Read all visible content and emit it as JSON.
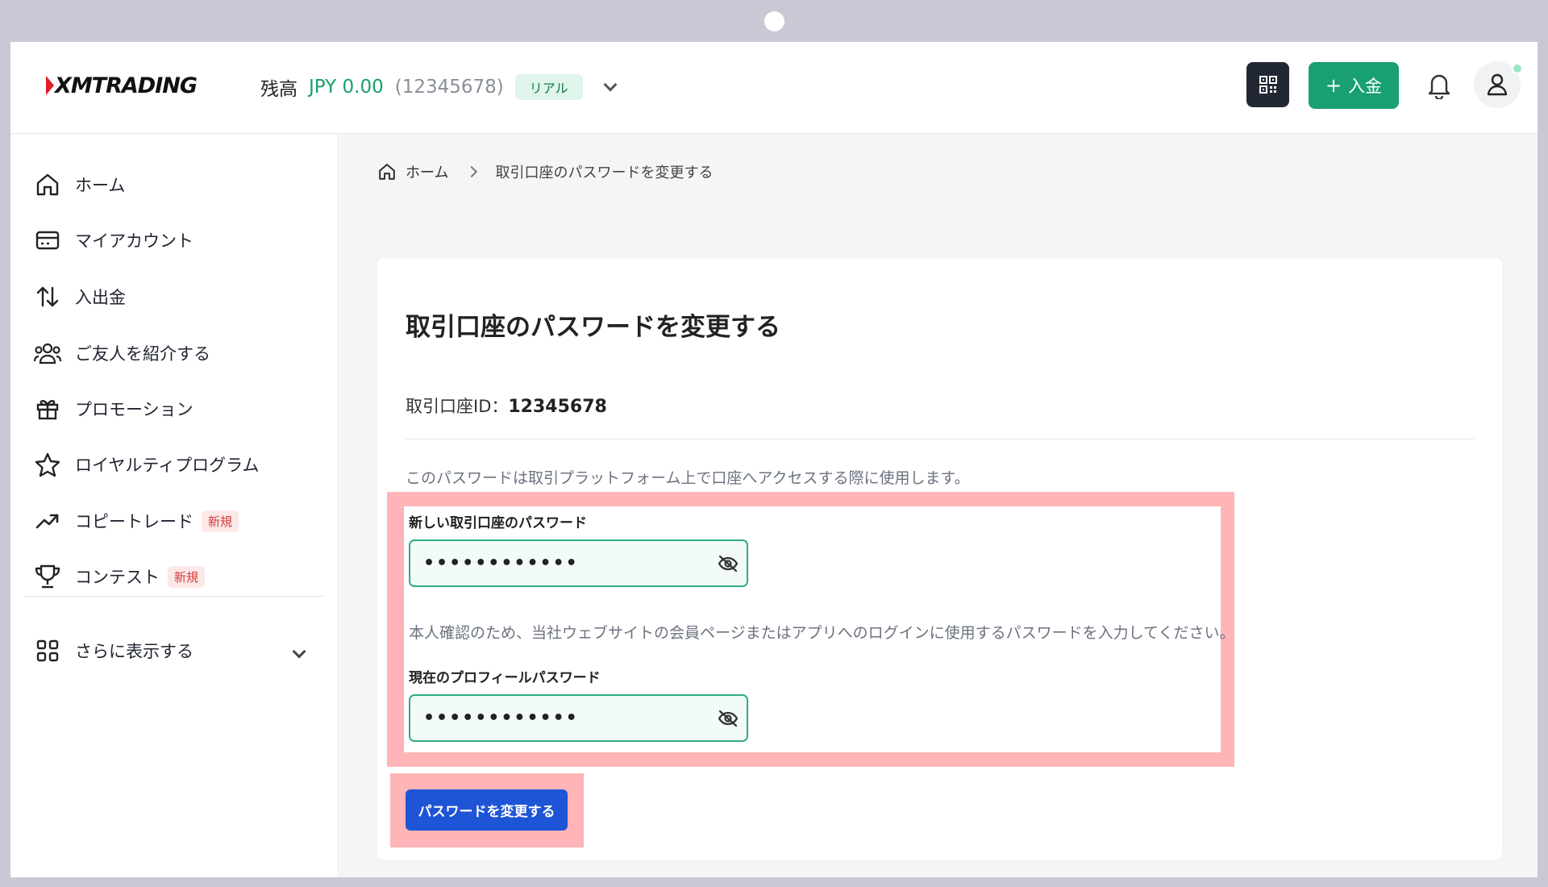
{
  "header": {
    "logo_text": "XMTRADING",
    "balance_label": "残高",
    "balance_amount": "JPY 0.00",
    "account_number": "(12345678)",
    "account_type": "リアル",
    "deposit_label": "入金"
  },
  "sidebar": {
    "items": [
      {
        "label": "ホーム",
        "icon": "home-icon"
      },
      {
        "label": "マイアカウント",
        "icon": "wallet-icon"
      },
      {
        "label": "入出金",
        "icon": "transfer-icon"
      },
      {
        "label": "ご友人を紹介する",
        "icon": "users-icon"
      },
      {
        "label": "プロモーション",
        "icon": "gift-icon"
      },
      {
        "label": "ロイヤルティプログラム",
        "icon": "star-icon"
      },
      {
        "label": "コピートレード",
        "icon": "trend-icon",
        "badge": "新規"
      },
      {
        "label": "コンテスト",
        "icon": "trophy-icon",
        "badge": "新規"
      }
    ],
    "more_label": "さらに表示する"
  },
  "breadcrumb": {
    "home": "ホーム",
    "current": "取引口座のパスワードを変更する"
  },
  "card": {
    "title": "取引口座のパスワードを変更する",
    "account_id_label": "取引口座ID：",
    "account_id_value": "12345678",
    "description": "このパスワードは取引プラットフォーム上で口座へアクセスする際に使用します。",
    "new_password_label": "新しい取引口座のパスワード",
    "new_password_value": "••••••••••••",
    "verify_description": "本人確認のため、当社ウェブサイトの会員ページまたはアプリへのログインに使用するパスワードを入力してください。",
    "current_password_label": "現在のプロフィールパスワード",
    "current_password_value": "••••••••••••",
    "submit_label": "パスワードを変更する"
  },
  "colors": {
    "brand_green": "#19a070",
    "primary_blue": "#1e54d6",
    "highlight": "#ffb4b7",
    "logo_red": "#e11d2a"
  }
}
